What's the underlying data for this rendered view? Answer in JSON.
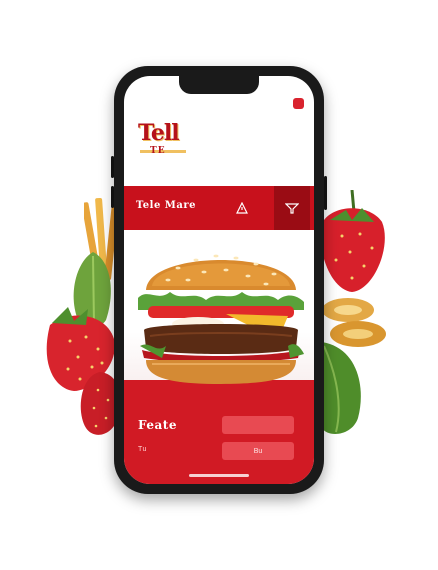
{
  "app": {
    "logo_text": "Tell",
    "logo_subtext": "TE",
    "header_title": "Tele Mare",
    "feature_title": "Feate",
    "feature_subtext": "Tu",
    "button_primary_label": "",
    "button_secondary_label": "Bu"
  },
  "icons": {
    "header_icon_1": "alert-icon",
    "header_icon_2": "filter-icon",
    "corner": "cart-icon"
  },
  "colors": {
    "brand_red": "#c8111c",
    "dark_red": "#9a0c14",
    "button_red": "#e84a52",
    "accent_yellow": "#f0c060"
  }
}
